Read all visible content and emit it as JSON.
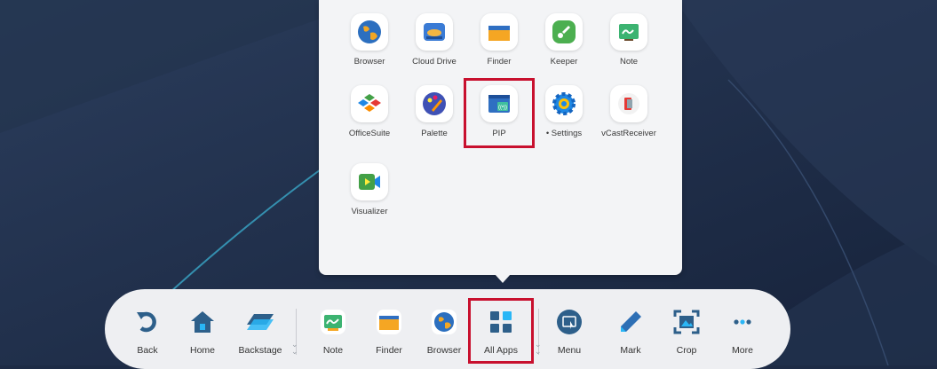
{
  "apps_panel": {
    "apps": [
      {
        "label": "Browser",
        "icon": "globe-icon"
      },
      {
        "label": "Cloud Drive",
        "icon": "cloud-drive-icon"
      },
      {
        "label": "Finder",
        "icon": "folder-icon"
      },
      {
        "label": "Keeper",
        "icon": "rocket-icon"
      },
      {
        "label": "Note",
        "icon": "whiteboard-icon"
      },
      {
        "label": "OfficeSuite",
        "icon": "officesuite-icon"
      },
      {
        "label": "Palette",
        "icon": "palette-icon"
      },
      {
        "label": "PIP",
        "icon": "pip-icon"
      },
      {
        "label": "• Settings",
        "icon": "gear-icon"
      },
      {
        "label": "vCastReceiver",
        "icon": "vcast-icon"
      },
      {
        "label": "Visualizer",
        "icon": "camera-icon"
      }
    ]
  },
  "dock": {
    "items": [
      {
        "label": "Back",
        "icon": "back-arrow-icon"
      },
      {
        "label": "Home",
        "icon": "home-icon"
      },
      {
        "label": "Backstage",
        "icon": "layers-icon"
      },
      {
        "label": "Note",
        "icon": "whiteboard-icon"
      },
      {
        "label": "Finder",
        "icon": "folder-icon"
      },
      {
        "label": "Browser",
        "icon": "globe-icon"
      },
      {
        "label": "All Apps",
        "icon": "grid-icon"
      },
      {
        "label": "Menu",
        "icon": "menu-screen-icon"
      },
      {
        "label": "Mark",
        "icon": "pen-icon"
      },
      {
        "label": "Crop",
        "icon": "crop-icon"
      },
      {
        "label": "More",
        "icon": "more-dots-icon"
      }
    ]
  },
  "colors": {
    "highlight": "#c8102e",
    "background": "#1d2b45",
    "panel": "#f3f4f6"
  }
}
